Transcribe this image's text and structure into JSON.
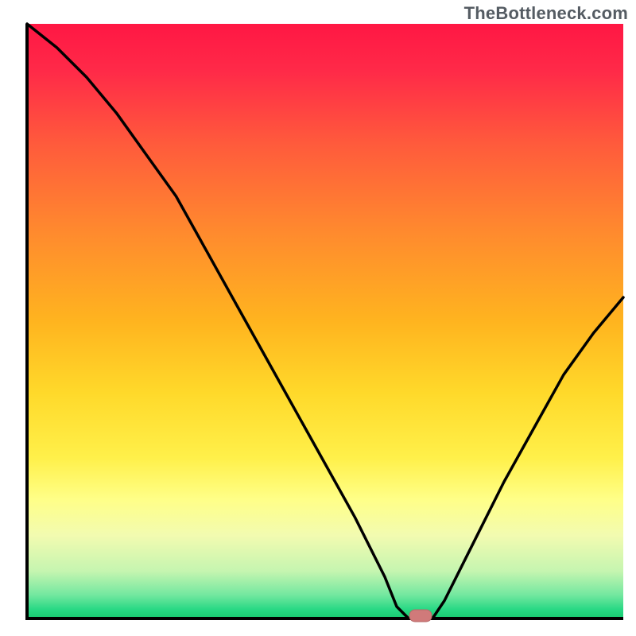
{
  "watermark": "TheBottleneck.com",
  "colors": {
    "gradient_stops": [
      {
        "offset": 0,
        "color": "#ff1744"
      },
      {
        "offset": 0.08,
        "color": "#ff2a48"
      },
      {
        "offset": 0.2,
        "color": "#ff5a3c"
      },
      {
        "offset": 0.35,
        "color": "#ff8a2e"
      },
      {
        "offset": 0.5,
        "color": "#ffb41f"
      },
      {
        "offset": 0.62,
        "color": "#ffd92a"
      },
      {
        "offset": 0.73,
        "color": "#fff04a"
      },
      {
        "offset": 0.8,
        "color": "#ffff88"
      },
      {
        "offset": 0.86,
        "color": "#f2fbb0"
      },
      {
        "offset": 0.92,
        "color": "#c6f5b0"
      },
      {
        "offset": 0.96,
        "color": "#74e8a0"
      },
      {
        "offset": 0.985,
        "color": "#28d884"
      },
      {
        "offset": 1.0,
        "color": "#17c96f"
      }
    ],
    "curve": "#000000",
    "marker_fill": "#d07a7a",
    "marker_stroke": "#b86a6a",
    "axis": "#000000",
    "background": "#ffffff"
  },
  "chart_data": {
    "type": "line",
    "title": "",
    "xlabel": "",
    "ylabel": "",
    "xlim": [
      0,
      100
    ],
    "ylim": [
      0,
      100
    ],
    "grid": false,
    "legend": null,
    "annotations": [
      "TheBottleneck.com"
    ],
    "marker": {
      "x": 66,
      "y": 0,
      "shape": "rounded-rect"
    },
    "series": [
      {
        "name": "bottleneck-curve",
        "x": [
          0,
          5,
          10,
          15,
          20,
          25,
          30,
          35,
          40,
          45,
          50,
          55,
          60,
          62,
          64,
          66,
          68,
          70,
          75,
          80,
          85,
          90,
          95,
          100
        ],
        "y": [
          100,
          96,
          91,
          85,
          78,
          71,
          62,
          53,
          44,
          35,
          26,
          17,
          7,
          2,
          0,
          0,
          0,
          3,
          13,
          23,
          32,
          41,
          48,
          54
        ]
      }
    ]
  }
}
